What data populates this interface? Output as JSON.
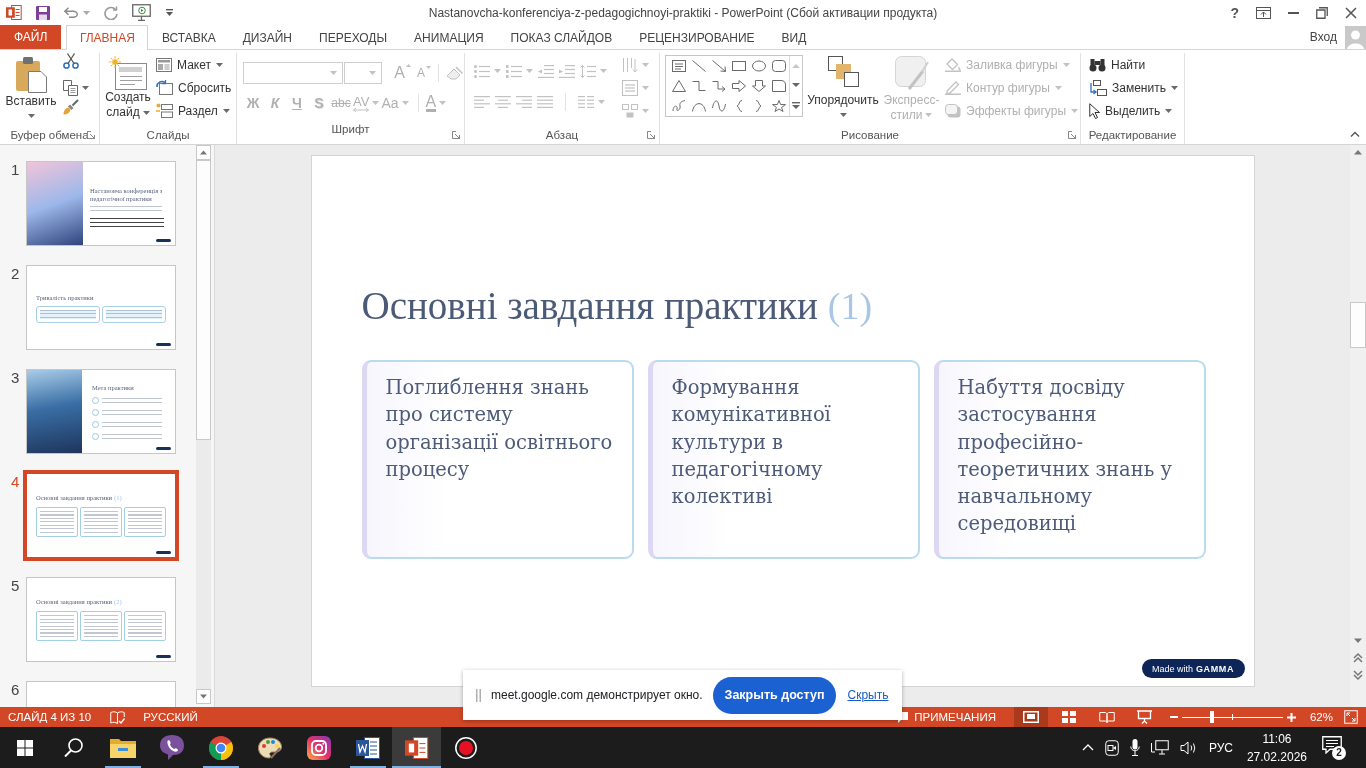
{
  "title_bar": {
    "title": "Nastanovcha-konferenciya-z-pedagogichnoyi-praktiki - PowerPoint (Сбой активации продукта)",
    "help": "?"
  },
  "tabs": [
    {
      "label": "ФАЙЛ",
      "kind": "file",
      "selected": false
    },
    {
      "label": "ГЛАВНАЯ",
      "kind": "tab",
      "selected": true
    },
    {
      "label": "ВСТАВКА",
      "kind": "tab",
      "selected": false
    },
    {
      "label": "ДИЗАЙН",
      "kind": "tab",
      "selected": false
    },
    {
      "label": "ПЕРЕХОДЫ",
      "kind": "tab",
      "selected": false
    },
    {
      "label": "АНИМАЦИЯ",
      "kind": "tab",
      "selected": false
    },
    {
      "label": "ПОКАЗ СЛАЙДОВ",
      "kind": "tab",
      "selected": false
    },
    {
      "label": "РЕЦЕНЗИРОВАНИЕ",
      "kind": "tab",
      "selected": false
    },
    {
      "label": "ВИД",
      "kind": "tab",
      "selected": false
    }
  ],
  "account": {
    "sign_in": "Вход"
  },
  "ribbon": {
    "clipboard": {
      "label": "Буфер обмена",
      "paste": "Вставить"
    },
    "slides": {
      "label": "Слайды",
      "new_slide": "Создать слайд",
      "layout": "Макет",
      "reset": "Сбросить",
      "section": "Раздел"
    },
    "font": {
      "label": "Шрифт",
      "disabled": true,
      "grow": "A",
      "shrink": "A",
      "styles": [
        "Ж",
        "К",
        "Ч",
        "S",
        "abc"
      ],
      "spacing": "AV",
      "change_case": "Aa",
      "text_fill_button": "A"
    },
    "paragraph": {
      "label": "Абзац",
      "disabled": true
    },
    "drawing": {
      "label": "Рисование",
      "arrange": "Упорядочить",
      "quick_styles": {
        "label": "Экспресс-стили",
        "disabled": true
      },
      "format": [
        {
          "label": "Заливка фигуры",
          "disabled": true
        },
        {
          "label": "Контур фигуры",
          "disabled": true
        },
        {
          "label": "Эффекты фигуры",
          "disabled": true
        }
      ]
    },
    "editing": {
      "label": "Редактирование",
      "find": "Найти",
      "replace": "Заменить",
      "select": "Выделить"
    }
  },
  "thumbnails": [
    {
      "number": "1",
      "kind": "title_photo",
      "title": "Настановча конференція з педагогічної практики",
      "selected": false
    },
    {
      "number": "2",
      "kind": "two_boxes",
      "title": "Тривалість практики",
      "selected": false
    },
    {
      "number": "3",
      "kind": "photo_list",
      "title": "Мета практики",
      "selected": false
    },
    {
      "number": "4",
      "kind": "three_cards",
      "title": "Основні завдання практики",
      "title_number": "(1)",
      "selected": true
    },
    {
      "number": "5",
      "kind": "three_cards",
      "title": "Основні завдання практики",
      "title_number": "(2)",
      "selected": false
    },
    {
      "number": "6",
      "kind": "blank",
      "selected": false
    }
  ],
  "slide": {
    "title": "Основні завдання практики",
    "title_number": "(1)",
    "cards": [
      "Поглиблення знань про систему організації освітнього процесу",
      "Формування комунікативної культури в педагогічному колективі",
      "Набуття досвіду застосування професійно-теоретичних знань у навчальному середовищі"
    ],
    "badge": "Made with **GAMMA**"
  },
  "screen_share_bar": {
    "message": "meet.google.com демонстрирует окно.",
    "stop_button": "Закрыть доступ",
    "hide_link": "Скрыть"
  },
  "status_bar": {
    "slide_indicator": "СЛАЙД 4 ИЗ 10",
    "language": "РУССКИЙ",
    "comments": "ПРИМЕЧАНИЯ",
    "views": [
      {
        "selected": true
      },
      {
        "selected": false
      },
      {
        "selected": false
      },
      {
        "selected": false
      }
    ],
    "zoom": {
      "level": 0.3,
      "percent": "62%"
    }
  },
  "taskbar": {
    "apps": [
      {
        "running": true,
        "selected": false
      },
      {
        "running": false,
        "selected": false
      },
      {
        "running": true,
        "selected": false
      },
      {
        "running": false,
        "selected": false
      },
      {
        "running": false,
        "selected": false
      },
      {
        "running": true,
        "selected": false
      },
      {
        "running": true,
        "selected": true
      },
      {
        "running": false,
        "selected": false
      }
    ],
    "language": "РУС",
    "time": "11:06",
    "date": "27.02.2026",
    "notifications": "2"
  }
}
